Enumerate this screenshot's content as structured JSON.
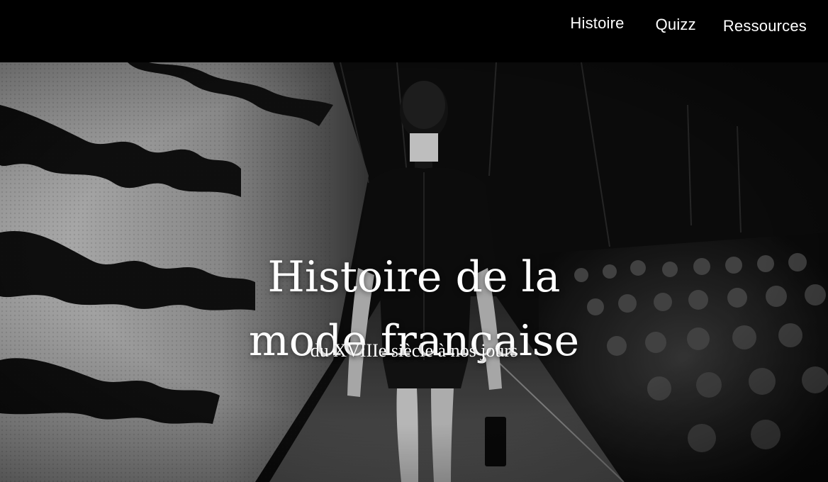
{
  "nav": {
    "items": [
      {
        "label": "Histoire"
      },
      {
        "label": "Quizz"
      },
      {
        "label": "Ressources"
      }
    ]
  },
  "hero": {
    "title_line1": "Histoire de la",
    "title_line2": "mode française",
    "subtitle": "du XVIIIe siècle à nos jours",
    "image_description": "runway-model-photo"
  },
  "colors": {
    "topbar": "#000000",
    "text": "#ffffff"
  }
}
